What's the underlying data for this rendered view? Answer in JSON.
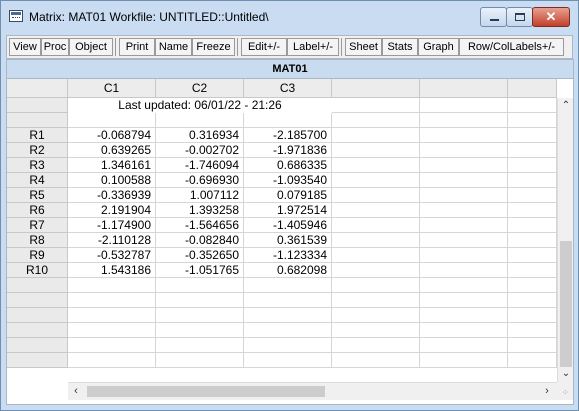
{
  "window": {
    "title": "Matrix: MAT01   Workfile: UNTITLED::Untitled\\"
  },
  "toolbar": {
    "buttons": [
      "View",
      "Proc",
      "Object",
      "Print",
      "Name",
      "Freeze",
      "Edit+/-",
      "Label+/-",
      "Sheet",
      "Stats",
      "Graph",
      "Row/ColLabels+/-"
    ]
  },
  "matrix": {
    "name": "MAT01",
    "columns": [
      "C1",
      "C2",
      "C3"
    ],
    "note": "Last updated: 06/01/22 - 21:26",
    "rows": [
      {
        "label": "R1",
        "values": [
          "-0.068794",
          "0.316934",
          "-2.185700"
        ]
      },
      {
        "label": "R2",
        "values": [
          "0.639265",
          "-0.002702",
          "-1.971836"
        ]
      },
      {
        "label": "R3",
        "values": [
          "1.346161",
          "-1.746094",
          "0.686335"
        ]
      },
      {
        "label": "R4",
        "values": [
          "0.100588",
          "-0.696930",
          "-1.093540"
        ]
      },
      {
        "label": "R5",
        "values": [
          "-0.336939",
          "1.007112",
          "0.079185"
        ]
      },
      {
        "label": "R6",
        "values": [
          "2.191904",
          "1.393258",
          "1.972514"
        ]
      },
      {
        "label": "R7",
        "values": [
          "-1.174900",
          "-1.564656",
          "-1.405946"
        ]
      },
      {
        "label": "R8",
        "values": [
          "-2.110128",
          "-0.082840",
          "0.361539"
        ]
      },
      {
        "label": "R9",
        "values": [
          "-0.532787",
          "-0.352650",
          "-1.123334"
        ]
      },
      {
        "label": "R10",
        "values": [
          "1.543186",
          "-1.051765",
          "0.682098"
        ]
      }
    ]
  },
  "scrollbars": {
    "up_icon": "chevron-up-icon",
    "down_icon": "chevron-down-icon",
    "left_icon": "chevron-left-icon",
    "right_icon": "chevron-right-icon"
  }
}
